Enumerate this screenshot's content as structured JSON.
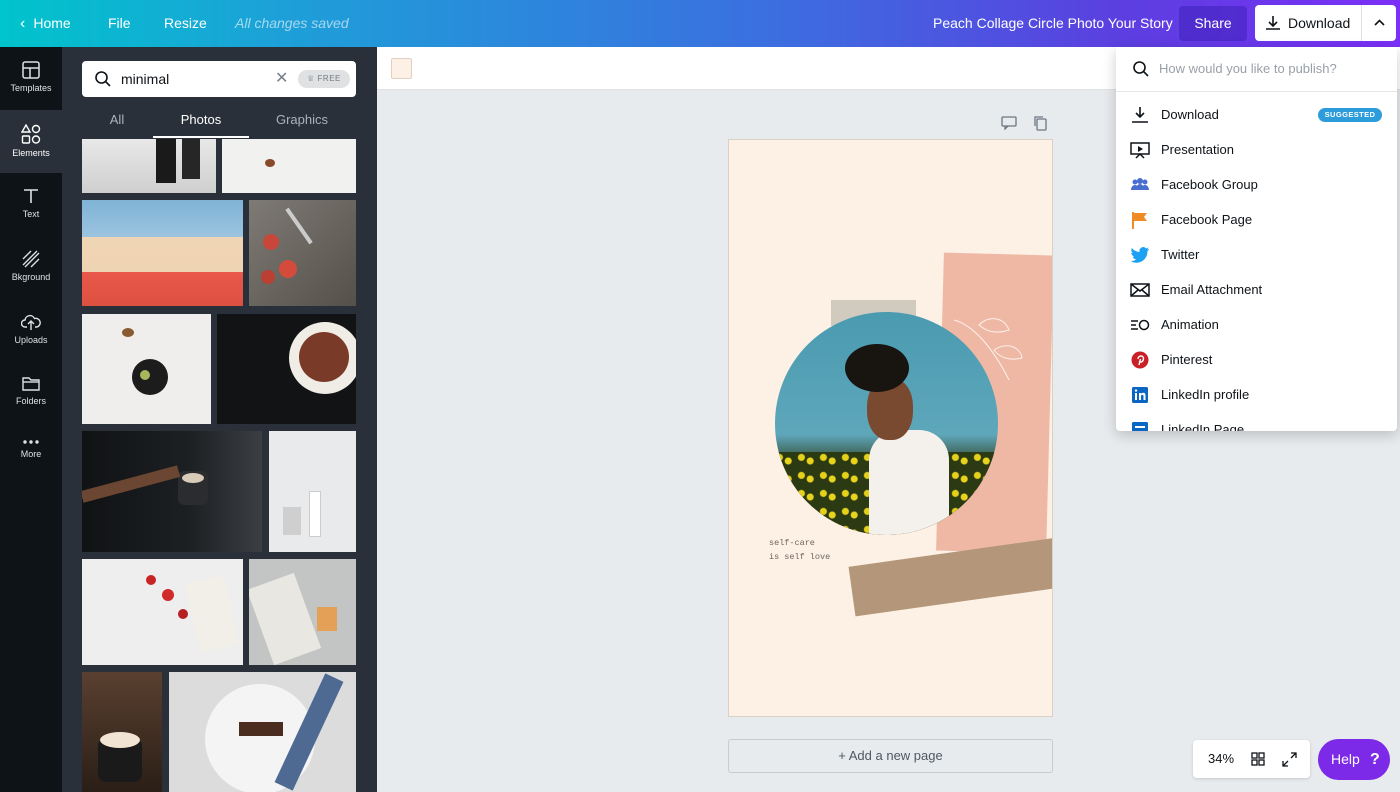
{
  "topbar": {
    "home": "Home",
    "file": "File",
    "resize": "Resize",
    "saved": "All changes saved",
    "title": "Peach Collage Circle Photo Your Story",
    "share": "Share",
    "download": "Download"
  },
  "sidenav": [
    {
      "label": "Templates",
      "icon": "templates-icon"
    },
    {
      "label": "Elements",
      "icon": "elements-icon"
    },
    {
      "label": "Text",
      "icon": "text-icon"
    },
    {
      "label": "Bkground",
      "icon": "background-icon"
    },
    {
      "label": "Uploads",
      "icon": "uploads-icon"
    },
    {
      "label": "Folders",
      "icon": "folders-icon"
    },
    {
      "label": "More",
      "icon": "more-icon"
    }
  ],
  "panel": {
    "search_value": "minimal",
    "free_badge": "FREE",
    "tabs": [
      "All",
      "Photos",
      "Graphics"
    ],
    "active_tab": "Photos"
  },
  "canvas": {
    "text_line1": "self-care",
    "text_line2": "is self love",
    "add_page": "+ Add a new page",
    "background_color": "#fdf0e4"
  },
  "zoom": "34%",
  "help": "Help",
  "dropdown": {
    "placeholder": "How would you like to publish?",
    "suggested_badge": "SUGGESTED",
    "items": [
      {
        "label": "Download",
        "icon": "download-icon"
      },
      {
        "label": "Presentation",
        "icon": "presentation-icon"
      },
      {
        "label": "Facebook Group",
        "icon": "facebook-group-icon"
      },
      {
        "label": "Facebook Page",
        "icon": "facebook-page-icon"
      },
      {
        "label": "Twitter",
        "icon": "twitter-icon"
      },
      {
        "label": "Email Attachment",
        "icon": "email-icon"
      },
      {
        "label": "Animation",
        "icon": "animation-icon"
      },
      {
        "label": "Pinterest",
        "icon": "pinterest-icon"
      },
      {
        "label": "LinkedIn profile",
        "icon": "linkedin-icon"
      },
      {
        "label": "LinkedIn Page",
        "icon": "linkedin-page-icon"
      }
    ]
  },
  "colors": {
    "accent": "#7d2ae8",
    "panel_bg": "#293039",
    "nav_bg": "#0e1318"
  }
}
